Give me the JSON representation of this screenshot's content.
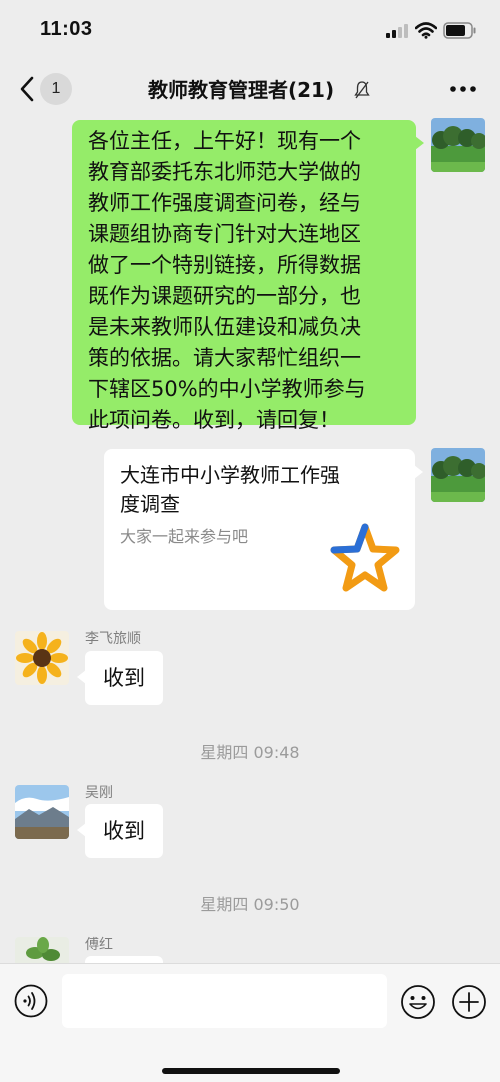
{
  "status_bar": {
    "time": "11:03"
  },
  "nav": {
    "unread_count": "1",
    "title": "教师教育管理者(21)"
  },
  "messages": {
    "outgoing_text_lines": [
      "各位主任，上午好！现有一个",
      "教育部委托东北师范大学做的",
      "教师工作强度调查问卷，经与",
      "课题组协商专门针对大连地区",
      "做了一个特别链接，所得数据",
      "既作为课题研究的一部分，也",
      "是未来教师队伍建设和减负决",
      "策的依据。请大家帮忙组织一",
      "下辖区50%的中小学教师参与",
      "此项问卷。收到，请回复！"
    ],
    "link_card": {
      "title_lines": [
        "大连市中小学教师工作强",
        "度调查"
      ],
      "description": "大家一起来参与吧"
    },
    "reply1": {
      "sender": "李飞旅顺",
      "text": "收到"
    },
    "timestamp1": "星期四 09:48",
    "reply2": {
      "sender": "吴刚",
      "text": "收到"
    },
    "timestamp2": "星期四 09:50",
    "reply3": {
      "sender": "傅红"
    }
  },
  "icons": {
    "back": "chevron-left-icon",
    "mute": "mute-icon",
    "more": "more-icon",
    "voice": "voice-icon",
    "emoji": "emoji-icon",
    "add": "plus-icon"
  },
  "colors": {
    "outgoing_bubble": "#95ec69",
    "background": "#ededed"
  }
}
